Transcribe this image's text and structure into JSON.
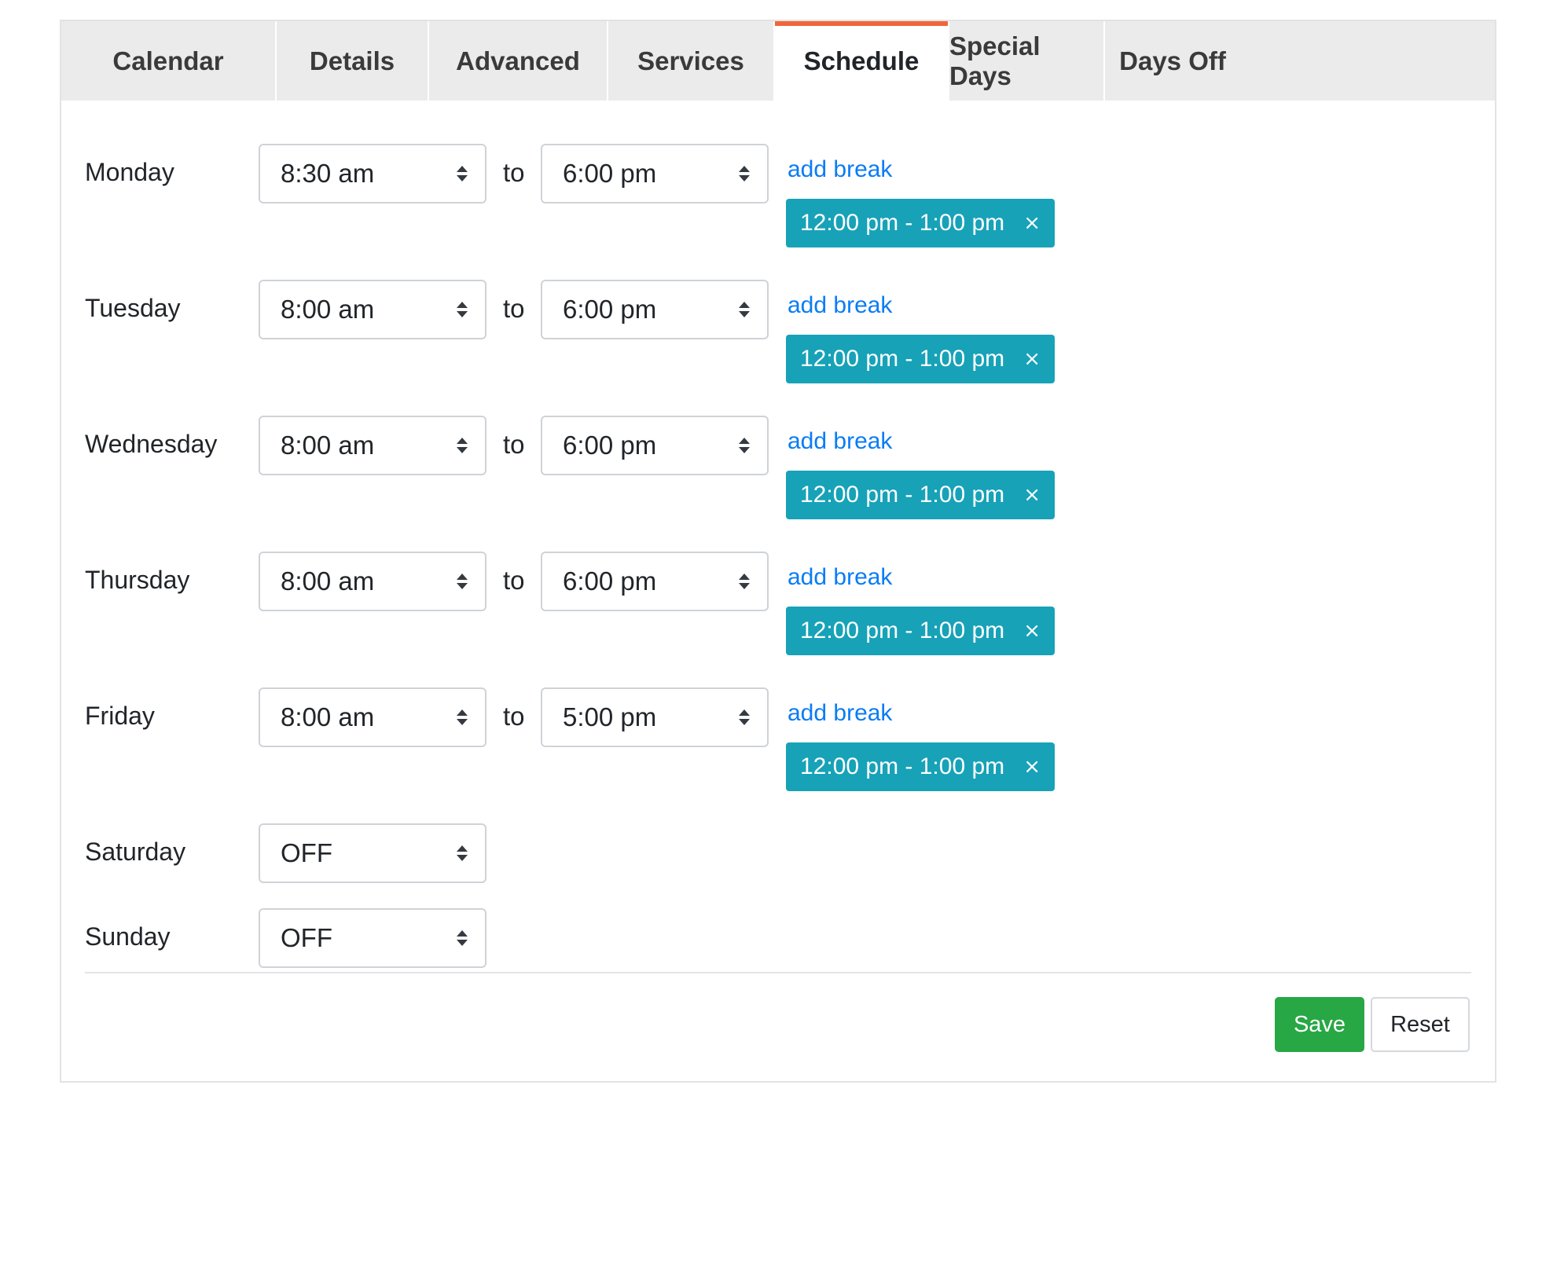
{
  "colors": {
    "accent": "#f0663b",
    "break_pill": "#17a2b8",
    "save_button": "#28a745",
    "link": "#0a7cf5"
  },
  "tabs": [
    {
      "label": "Calendar",
      "active": false
    },
    {
      "label": "Details",
      "active": false
    },
    {
      "label": "Advanced",
      "active": false
    },
    {
      "label": "Services",
      "active": false
    },
    {
      "label": "Schedule",
      "active": true
    },
    {
      "label": "Special Days",
      "active": false
    },
    {
      "label": "Days Off",
      "active": false
    }
  ],
  "schedule": {
    "to_label": "to",
    "add_break_label": "add break",
    "close_glyph": "×",
    "days": [
      {
        "day": "Monday",
        "start": "8:30 am",
        "end": "6:00 pm",
        "breaks": [
          "12:00 pm - 1:00 pm"
        ]
      },
      {
        "day": "Tuesday",
        "start": "8:00 am",
        "end": "6:00 pm",
        "breaks": [
          "12:00 pm - 1:00 pm"
        ]
      },
      {
        "day": "Wednesday",
        "start": "8:00 am",
        "end": "6:00 pm",
        "breaks": [
          "12:00 pm - 1:00 pm"
        ]
      },
      {
        "day": "Thursday",
        "start": "8:00 am",
        "end": "6:00 pm",
        "breaks": [
          "12:00 pm - 1:00 pm"
        ]
      },
      {
        "day": "Friday",
        "start": "8:00 am",
        "end": "5:00 pm",
        "breaks": [
          "12:00 pm - 1:00 pm"
        ]
      },
      {
        "day": "Saturday",
        "start": "OFF",
        "end": null,
        "breaks": []
      },
      {
        "day": "Sunday",
        "start": "OFF",
        "end": null,
        "breaks": []
      }
    ]
  },
  "actions": {
    "save_label": "Save",
    "reset_label": "Reset"
  }
}
